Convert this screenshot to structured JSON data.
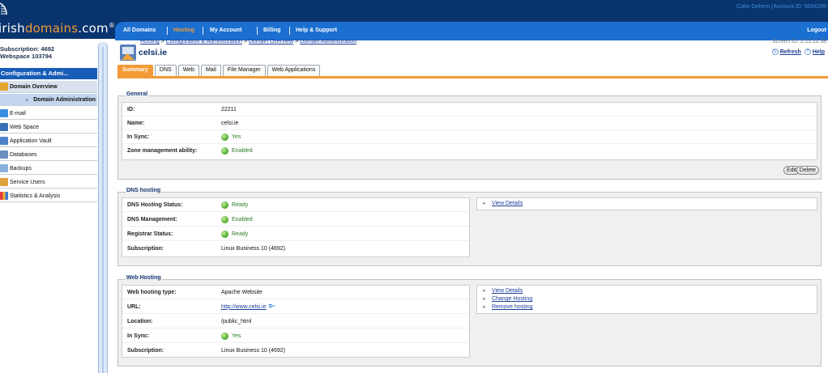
{
  "header": {
    "logo_prefix": "irish",
    "logo_highlight": "domains",
    "logo_suffix": ".com",
    "logo_reg": "®",
    "account": "Colm Gelrem (Account ID: 5004295",
    "nav": [
      "All Domains",
      "Hosting",
      "My Account",
      "Billing",
      "Help & Support"
    ],
    "logout": "Logout",
    "active_nav": "Hosting"
  },
  "sidebar": {
    "subscription": "Subscription: 4692",
    "webspace": "Webspace 103794",
    "section": "Configuration & Admi...",
    "items": [
      {
        "label": "Domain Overview",
        "icon": "domain-overview-icon"
      },
      {
        "label": "Domain Administration",
        "icon": "arrow-icon"
      },
      {
        "label": "E-mail",
        "icon": "email-icon"
      },
      {
        "label": "Web Space",
        "icon": "web-space-icon"
      },
      {
        "label": "Application Vault",
        "icon": "application-vault-icon"
      },
      {
        "label": "Databases",
        "icon": "databases-icon"
      },
      {
        "label": "Backups",
        "icon": "backups-icon"
      },
      {
        "label": "Service Users",
        "icon": "service-users-icon"
      },
      {
        "label": "Statistics & Analysis",
        "icon": "statistics-icon"
      }
    ]
  },
  "main": {
    "breadcrumb": [
      "Hosting",
      "Configuration & Administration",
      "Domain Overview",
      "Domain Administration"
    ],
    "breadcrumb_sep": " > ",
    "domain": "celsi.ie",
    "screen_id": "Screen ID: 2.11.11.38",
    "refresh": "Refresh",
    "help": "Help",
    "tabs": [
      "Summary",
      "DNS",
      "Web",
      "Mail",
      "File Manager",
      "Web Applications"
    ],
    "general": {
      "title": "General",
      "rows": [
        {
          "label": "ID:",
          "value": "22211"
        },
        {
          "label": "Name:",
          "value": "celsi.ie"
        },
        {
          "label": "In Sync:",
          "value": "Yes"
        },
        {
          "label": "Zone management ability:",
          "value": "Enabled"
        }
      ],
      "edit": "Edit",
      "delete": "Delete"
    },
    "dns": {
      "title": "DNS hosting",
      "rows": [
        {
          "label": "DNS Hosting Status:",
          "value": "Ready"
        },
        {
          "label": "DNS Management:",
          "value": "Enabled"
        },
        {
          "label": "Registrar Status:",
          "value": "Ready"
        },
        {
          "label": "Subscription:",
          "value": "Linux Business 10 (4692)"
        }
      ],
      "links": [
        "View Details"
      ]
    },
    "web": {
      "title": "Web Hosting",
      "rows": [
        {
          "label": "Web hosting type:",
          "value": "Apache Website"
        },
        {
          "label": "URL:",
          "value": "http://www.celsi.ie"
        },
        {
          "label": "Location:",
          "value": "/public_html"
        },
        {
          "label": "In Sync:",
          "value": "Yes"
        },
        {
          "label": "Subscription:",
          "value": "Linux Business 10 (4692)"
        }
      ],
      "links": [
        "View Details",
        "Change Hosting",
        "Remove hosting"
      ]
    }
  }
}
